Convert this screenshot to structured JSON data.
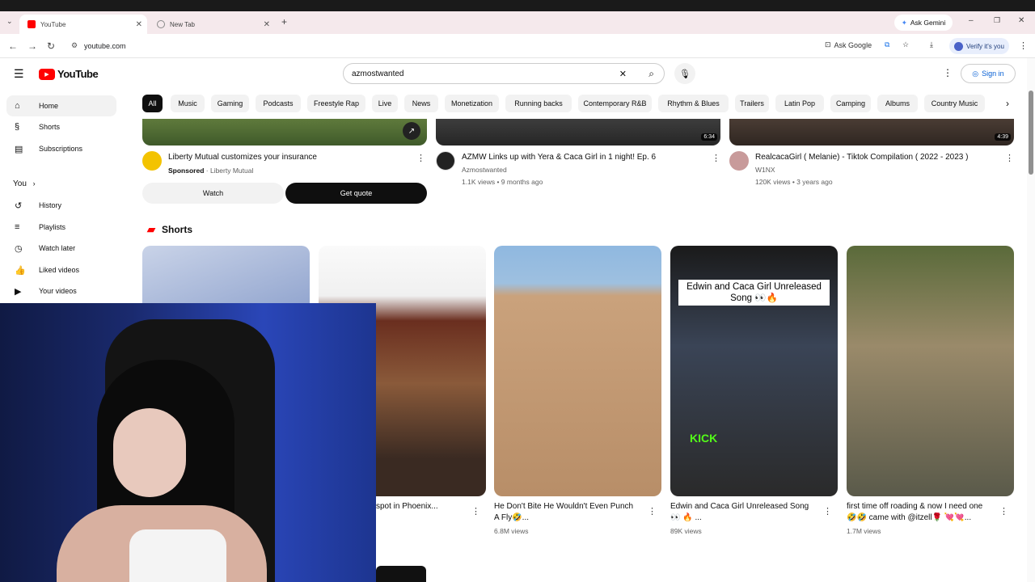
{
  "browser": {
    "tabs": [
      {
        "label": "YouTube",
        "active": true
      },
      {
        "label": "New Tab",
        "active": false
      }
    ],
    "ask_gemini": "Ask Gemini",
    "url": "youtube.com",
    "ask_google": "Ask Google",
    "verify": "Verify it's you"
  },
  "header": {
    "logo": "YouTube",
    "search_value": "azmostwanted",
    "signin": "Sign in"
  },
  "sidebar": {
    "items": [
      {
        "label": "Home",
        "icon": "home-icon"
      },
      {
        "label": "Shorts",
        "icon": "shorts-icon"
      },
      {
        "label": "Subscriptions",
        "icon": "subscriptions-icon"
      }
    ],
    "you_label": "You",
    "you_items": [
      {
        "label": "History",
        "icon": "history-icon"
      },
      {
        "label": "Playlists",
        "icon": "playlists-icon"
      },
      {
        "label": "Watch later",
        "icon": "clock-icon"
      },
      {
        "label": "Liked videos",
        "icon": "thumbs-up-icon"
      },
      {
        "label": "Your videos",
        "icon": "play-icon"
      }
    ]
  },
  "chips": [
    "All",
    "Music",
    "Gaming",
    "Podcasts",
    "Freestyle Rap",
    "Live",
    "News",
    "Monetization",
    "Running backs",
    "Contemporary R&B",
    "Rhythm & Blues",
    "Trailers",
    "Latin Pop",
    "Camping",
    "Albums",
    "Country Music"
  ],
  "ad": {
    "title": "Liberty Mutual customizes your insurance",
    "sponsored": "Sponsored",
    "advertiser": "Liberty Mutual",
    "watch_btn": "Watch",
    "quote_btn": "Get quote"
  },
  "videos": [
    {
      "title": "AZMW Links up with Yera & Caca Girl in 1 night! Ep. 6",
      "channel": "Azmostwanted",
      "meta": "1.1K views • 9 months ago",
      "duration": "6:34"
    },
    {
      "title": "RealcacaGirl ( Melanie) - Tiktok Compilation ( 2022 - 2023 )",
      "channel": "W1NX",
      "meta": "120K views • 3 years ago",
      "duration": "4:39"
    }
  ],
  "shorts": {
    "heading": "Shorts",
    "items": [
      {
        "title": "",
        "views": ""
      },
      {
        "title": "spot in Phoenix...",
        "views": ""
      },
      {
        "title": "He Don't Bite He Wouldn't Even Punch A Fly🤣...",
        "views": "6.8M views"
      },
      {
        "title": "Edwin and Caca Girl Unreleased Song 👀 🔥 ...",
        "views": "89K views",
        "overlay": "Edwin and Caca Girl Unreleased Song 👀🔥",
        "kick": "KICK"
      },
      {
        "title": "first time off roading & now I need one 🤣🤣 came with @itzell🌹 💘💘...",
        "views": "1.7M views"
      }
    ]
  }
}
